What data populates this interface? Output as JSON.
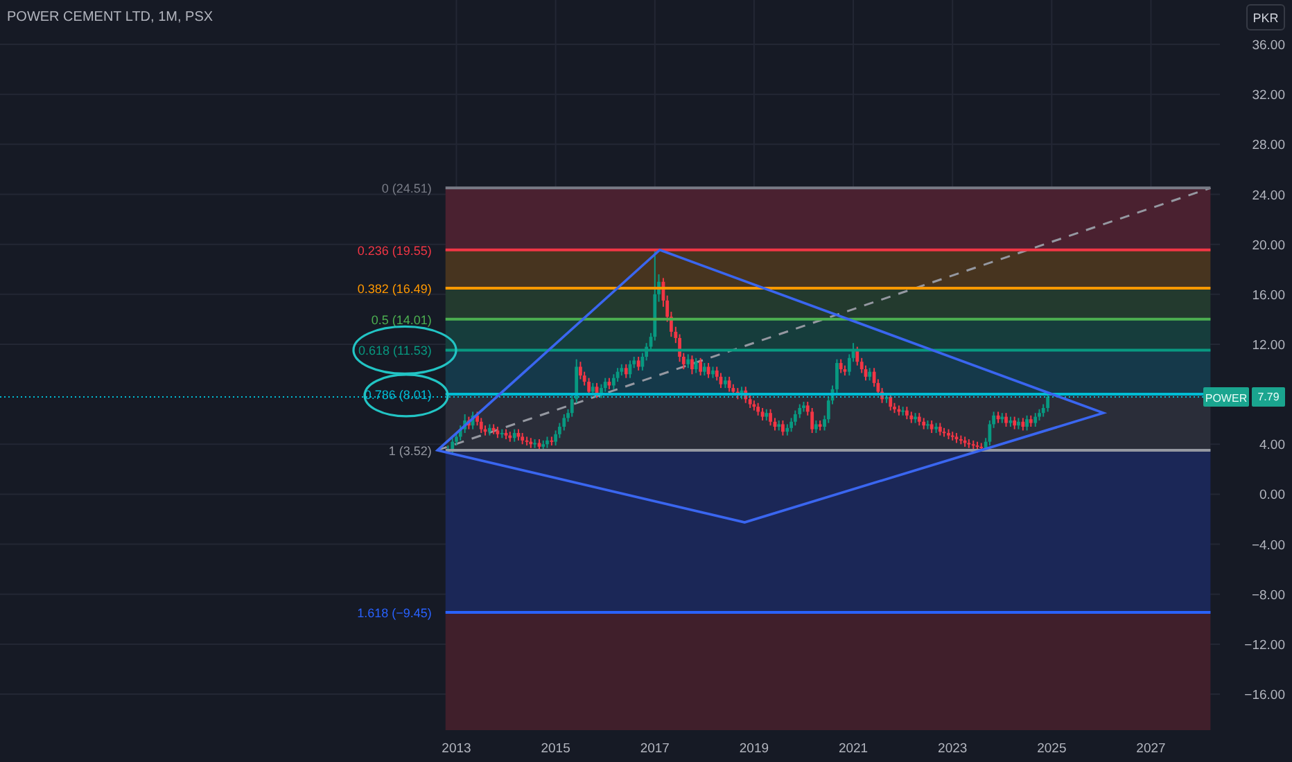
{
  "title": "POWER CEMENT LTD, 1M, PSX",
  "currency_button": "PKR",
  "chart": {
    "chart_data": {
      "type": "candlestick",
      "grid": true,
      "xlim": [
        2003.8,
        2028.39
      ],
      "ylim": [
        -18.88,
        39.55
      ],
      "xticks": [
        2013,
        2015,
        2017,
        2019,
        2021,
        2023,
        2025,
        2027
      ],
      "yticks": [
        {
          "value": 36,
          "label": "36.00"
        },
        {
          "value": 32,
          "label": "32.00"
        },
        {
          "value": 28,
          "label": "28.00"
        },
        {
          "value": 24,
          "label": "24.00"
        },
        {
          "value": 20,
          "label": "20.00"
        },
        {
          "value": 16,
          "label": "16.00"
        },
        {
          "value": 12,
          "label": "12.00"
        },
        {
          "value": 4,
          "label": "4.00"
        },
        {
          "value": 0,
          "label": "0.00"
        },
        {
          "value": -4,
          "label": "−4.00"
        },
        {
          "value": -8,
          "label": "−8.00"
        },
        {
          "value": -12,
          "label": "−12.00"
        },
        {
          "value": -16,
          "label": "−16.00"
        }
      ],
      "x": [
        2012.83,
        2012.92,
        2013.0,
        2013.08,
        2013.17,
        2013.25,
        2013.33,
        2013.42,
        2013.5,
        2013.58,
        2013.67,
        2013.75,
        2013.83,
        2013.92,
        2014.0,
        2014.08,
        2014.17,
        2014.25,
        2014.33,
        2014.42,
        2014.5,
        2014.58,
        2014.67,
        2014.75,
        2014.83,
        2014.92,
        2015.0,
        2015.08,
        2015.17,
        2015.25,
        2015.33,
        2015.42,
        2015.5,
        2015.58,
        2015.67,
        2015.75,
        2015.83,
        2015.92,
        2016.0,
        2016.08,
        2016.17,
        2016.25,
        2016.33,
        2016.42,
        2016.5,
        2016.58,
        2016.67,
        2016.75,
        2016.83,
        2016.92,
        2017.0,
        2017.08,
        2017.17,
        2017.25,
        2017.33,
        2017.42,
        2017.5,
        2017.58,
        2017.67,
        2017.75,
        2017.83,
        2017.92,
        2018.0,
        2018.08,
        2018.17,
        2018.25,
        2018.33,
        2018.42,
        2018.5,
        2018.58,
        2018.67,
        2018.75,
        2018.83,
        2018.92,
        2019.0,
        2019.08,
        2019.17,
        2019.25,
        2019.33,
        2019.42,
        2019.5,
        2019.58,
        2019.67,
        2019.75,
        2019.83,
        2019.92,
        2020.0,
        2020.08,
        2020.17,
        2020.25,
        2020.33,
        2020.42,
        2020.5,
        2020.58,
        2020.67,
        2020.75,
        2020.83,
        2020.92,
        2021.0,
        2021.08,
        2021.17,
        2021.25,
        2021.33,
        2021.42,
        2021.5,
        2021.58,
        2021.67,
        2021.75,
        2021.83,
        2021.92,
        2022.0,
        2022.08,
        2022.17,
        2022.25,
        2022.33,
        2022.42,
        2022.5,
        2022.58,
        2022.67,
        2022.75,
        2022.83,
        2022.92,
        2023.0,
        2023.08,
        2023.17,
        2023.25,
        2023.33,
        2023.42,
        2023.5,
        2023.58,
        2023.67,
        2023.75,
        2023.83,
        2023.92,
        2024.0,
        2024.08,
        2024.17,
        2024.25,
        2024.33,
        2024.42,
        2024.5,
        2024.58,
        2024.67,
        2024.75,
        2024.83,
        2024.92
      ],
      "ohlc": [
        [
          3.5,
          3.9,
          3.3,
          3.6
        ],
        [
          3.6,
          4.5,
          3.3,
          4.2
        ],
        [
          4.2,
          4.9,
          3.9,
          4.6
        ],
        [
          4.6,
          5.5,
          4.3,
          5.2
        ],
        [
          5.2,
          6.4,
          4.9,
          5.9
        ],
        [
          5.9,
          6.2,
          5.2,
          5.5
        ],
        [
          5.5,
          6.6,
          5.2,
          6.3
        ],
        [
          6.3,
          6.6,
          5.5,
          5.8
        ],
        [
          5.8,
          6.1,
          4.9,
          5.2
        ],
        [
          5.2,
          5.5,
          4.7,
          5.0
        ],
        [
          5.0,
          5.6,
          4.7,
          5.3
        ],
        [
          5.3,
          5.6,
          4.8,
          5.1
        ],
        [
          5.1,
          5.4,
          4.5,
          4.8
        ],
        [
          4.8,
          5.2,
          4.5,
          4.9
        ],
        [
          4.9,
          5.2,
          4.4,
          4.7
        ],
        [
          4.7,
          5.0,
          4.2,
          4.5
        ],
        [
          4.5,
          5.2,
          4.2,
          4.9
        ],
        [
          4.9,
          5.2,
          4.3,
          4.6
        ],
        [
          4.6,
          4.9,
          4.0,
          4.3
        ],
        [
          4.3,
          4.6,
          3.9,
          4.2
        ],
        [
          4.2,
          4.5,
          3.7,
          4.0
        ],
        [
          4.0,
          4.4,
          3.7,
          4.1
        ],
        [
          4.1,
          4.4,
          3.5,
          3.8
        ],
        [
          3.8,
          4.3,
          3.5,
          4.0
        ],
        [
          4.0,
          4.6,
          3.7,
          4.3
        ],
        [
          4.3,
          4.6,
          3.9,
          4.2
        ],
        [
          4.2,
          5.1,
          3.9,
          4.8
        ],
        [
          4.8,
          5.7,
          4.5,
          5.4
        ],
        [
          5.4,
          6.4,
          5.1,
          6.1
        ],
        [
          6.1,
          6.8,
          5.8,
          6.5
        ],
        [
          6.5,
          7.9,
          6.2,
          7.6
        ],
        [
          7.6,
          10.8,
          7.3,
          10.2
        ],
        [
          10.2,
          10.6,
          9.2,
          9.5
        ],
        [
          9.5,
          9.8,
          8.7,
          9.0
        ],
        [
          9.0,
          9.3,
          7.9,
          8.2
        ],
        [
          8.2,
          8.9,
          7.9,
          8.6
        ],
        [
          8.6,
          8.9,
          7.7,
          8.0
        ],
        [
          8.0,
          8.8,
          7.7,
          8.5
        ],
        [
          8.5,
          9.3,
          8.2,
          9.0
        ],
        [
          9.0,
          9.3,
          8.4,
          8.7
        ],
        [
          8.7,
          9.6,
          8.4,
          9.3
        ],
        [
          9.3,
          10.1,
          9.0,
          9.8
        ],
        [
          9.8,
          10.4,
          9.5,
          10.1
        ],
        [
          10.1,
          10.4,
          9.3,
          9.6
        ],
        [
          9.6,
          10.7,
          9.3,
          10.4
        ],
        [
          10.4,
          11.0,
          10.1,
          10.7
        ],
        [
          10.7,
          11.0,
          9.9,
          10.2
        ],
        [
          10.2,
          11.3,
          9.9,
          11.0
        ],
        [
          11.0,
          12.1,
          10.7,
          11.8
        ],
        [
          11.8,
          12.9,
          11.5,
          12.6
        ],
        [
          12.6,
          19.55,
          12.3,
          16.0
        ],
        [
          16.0,
          17.6,
          15.4,
          17.0
        ],
        [
          17.0,
          17.3,
          15.0,
          15.5
        ],
        [
          15.5,
          15.9,
          13.8,
          14.2
        ],
        [
          14.2,
          14.6,
          12.6,
          13.0
        ],
        [
          13.0,
          13.4,
          12.1,
          12.5
        ],
        [
          12.5,
          12.8,
          10.6,
          11.0
        ],
        [
          11.0,
          11.3,
          10.0,
          10.4
        ],
        [
          10.4,
          11.2,
          10.1,
          10.8
        ],
        [
          10.8,
          11.1,
          9.6,
          10.0
        ],
        [
          10.0,
          10.9,
          9.7,
          10.6
        ],
        [
          10.6,
          10.9,
          9.5,
          9.8
        ],
        [
          9.8,
          10.5,
          9.5,
          10.2
        ],
        [
          10.2,
          10.5,
          9.3,
          9.6
        ],
        [
          9.6,
          10.2,
          9.3,
          9.9
        ],
        [
          9.9,
          10.2,
          9.1,
          9.4
        ],
        [
          9.4,
          9.7,
          8.5,
          8.8
        ],
        [
          8.8,
          9.4,
          8.5,
          9.1
        ],
        [
          9.1,
          9.4,
          8.2,
          8.5
        ],
        [
          8.5,
          8.8,
          7.9,
          8.2
        ],
        [
          8.2,
          8.5,
          7.6,
          7.9
        ],
        [
          7.9,
          8.6,
          7.6,
          8.3
        ],
        [
          8.3,
          8.6,
          7.3,
          7.6
        ],
        [
          7.6,
          7.9,
          6.9,
          7.2
        ],
        [
          7.2,
          7.5,
          6.7,
          7.0
        ],
        [
          7.0,
          7.3,
          6.3,
          6.6
        ],
        [
          6.6,
          6.9,
          5.9,
          6.2
        ],
        [
          6.2,
          6.8,
          5.9,
          6.5
        ],
        [
          6.5,
          6.8,
          5.5,
          5.8
        ],
        [
          5.8,
          6.1,
          5.1,
          5.4
        ],
        [
          5.4,
          5.9,
          5.1,
          5.6
        ],
        [
          5.6,
          5.9,
          4.7,
          5.0
        ],
        [
          5.0,
          5.6,
          4.7,
          5.3
        ],
        [
          5.3,
          6.1,
          5.0,
          5.8
        ],
        [
          5.8,
          6.7,
          5.5,
          6.4
        ],
        [
          6.4,
          7.2,
          6.1,
          6.9
        ],
        [
          6.9,
          7.4,
          6.6,
          7.1
        ],
        [
          7.1,
          7.4,
          6.3,
          6.6
        ],
        [
          6.6,
          6.9,
          4.9,
          5.2
        ],
        [
          5.2,
          5.9,
          4.9,
          5.6
        ],
        [
          5.6,
          5.9,
          5.1,
          5.4
        ],
        [
          5.4,
          6.3,
          5.1,
          6.0
        ],
        [
          6.0,
          7.8,
          5.7,
          7.5
        ],
        [
          7.5,
          8.7,
          7.2,
          8.4
        ],
        [
          8.4,
          10.8,
          8.1,
          10.5
        ],
        [
          10.5,
          10.8,
          9.7,
          10.0
        ],
        [
          10.0,
          10.3,
          9.5,
          9.8
        ],
        [
          9.8,
          11.2,
          9.5,
          10.9
        ],
        [
          10.9,
          12.1,
          10.6,
          11.5
        ],
        [
          11.5,
          11.8,
          10.3,
          10.6
        ],
        [
          10.6,
          10.9,
          9.7,
          10.0
        ],
        [
          10.0,
          10.3,
          9.1,
          9.4
        ],
        [
          9.4,
          10.1,
          9.1,
          9.8
        ],
        [
          9.8,
          10.1,
          8.6,
          8.9
        ],
        [
          8.9,
          9.2,
          7.9,
          8.2
        ],
        [
          8.2,
          8.5,
          7.3,
          7.6
        ],
        [
          7.6,
          8.1,
          7.3,
          7.8
        ],
        [
          7.8,
          8.1,
          6.7,
          7.0
        ],
        [
          7.0,
          7.3,
          6.5,
          6.8
        ],
        [
          6.8,
          7.1,
          6.3,
          6.6
        ],
        [
          6.6,
          7.0,
          6.3,
          6.7
        ],
        [
          6.7,
          7.0,
          6.0,
          6.3
        ],
        [
          6.3,
          6.6,
          5.7,
          6.0
        ],
        [
          6.0,
          6.5,
          5.7,
          6.2
        ],
        [
          6.2,
          6.5,
          5.5,
          5.8
        ],
        [
          5.8,
          6.1,
          5.2,
          5.5
        ],
        [
          5.5,
          5.9,
          5.2,
          5.6
        ],
        [
          5.6,
          5.9,
          4.9,
          5.2
        ],
        [
          5.2,
          5.7,
          4.9,
          5.4
        ],
        [
          5.4,
          5.7,
          4.7,
          5.0
        ],
        [
          5.0,
          5.3,
          4.6,
          4.9
        ],
        [
          4.9,
          5.2,
          4.4,
          4.7
        ],
        [
          4.7,
          5.0,
          4.3,
          4.6
        ],
        [
          4.6,
          4.9,
          4.1,
          4.4
        ],
        [
          4.4,
          4.7,
          4.0,
          4.3
        ],
        [
          4.3,
          4.6,
          3.8,
          4.1
        ],
        [
          4.1,
          4.4,
          3.7,
          4.0
        ],
        [
          4.0,
          4.3,
          3.6,
          3.9
        ],
        [
          3.9,
          4.2,
          3.5,
          3.8
        ],
        [
          3.8,
          4.1,
          3.5,
          3.7
        ],
        [
          3.7,
          4.5,
          3.4,
          4.2
        ],
        [
          4.2,
          5.9,
          3.9,
          5.6
        ],
        [
          5.6,
          6.6,
          5.3,
          6.3
        ],
        [
          6.3,
          6.6,
          5.7,
          6.0
        ],
        [
          6.0,
          6.5,
          5.7,
          6.2
        ],
        [
          6.2,
          6.5,
          5.4,
          5.7
        ],
        [
          5.7,
          6.2,
          5.4,
          5.9
        ],
        [
          5.9,
          6.2,
          5.2,
          5.5
        ],
        [
          5.5,
          6.1,
          5.2,
          5.8
        ],
        [
          5.8,
          6.1,
          5.1,
          5.4
        ],
        [
          5.4,
          6.3,
          5.1,
          6.0
        ],
        [
          6.0,
          6.3,
          5.4,
          5.7
        ],
        [
          5.7,
          6.5,
          5.4,
          6.2
        ],
        [
          6.2,
          6.8,
          5.9,
          6.5
        ],
        [
          6.5,
          7.2,
          6.2,
          6.9
        ],
        [
          6.9,
          8.1,
          6.6,
          7.79
        ]
      ],
      "bands": [
        {
          "axis": "y",
          "from": 24.51,
          "to": 19.55,
          "color": "#4a2130"
        },
        {
          "axis": "y",
          "from": 19.55,
          "to": 16.49,
          "color": "#47341f"
        },
        {
          "axis": "y",
          "from": 16.49,
          "to": 14.01,
          "color": "#233a2e"
        },
        {
          "axis": "y",
          "from": 14.01,
          "to": 11.53,
          "color": "#163d3c"
        },
        {
          "axis": "y",
          "from": 11.53,
          "to": 8.01,
          "color": "#15394a"
        },
        {
          "axis": "y",
          "from": 8.01,
          "to": 3.52,
          "color": "#2a2d39"
        },
        {
          "axis": "y",
          "from": 3.52,
          "to": -9.45,
          "color": "#1b2757"
        },
        {
          "axis": "y",
          "from": -9.45,
          "to": -18.88,
          "color": "#401f2b"
        }
      ],
      "ref_lines": [
        {
          "axis": "y",
          "value": 24.51,
          "label": "0 (24.51)",
          "color": "#787b86"
        },
        {
          "axis": "y",
          "value": 19.55,
          "label": "0.236 (19.55)",
          "color": "#f23645"
        },
        {
          "axis": "y",
          "value": 16.49,
          "label": "0.382 (16.49)",
          "color": "#ff9800"
        },
        {
          "axis": "y",
          "value": 14.01,
          "label": "0.5 (14.01)",
          "color": "#4caf50"
        },
        {
          "axis": "y",
          "value": 11.53,
          "label": "0.618 (11.53)",
          "color": "#089981"
        },
        {
          "axis": "y",
          "value": 8.01,
          "label": "0.786 (8.01)",
          "color": "#00bcd4"
        },
        {
          "axis": "y",
          "value": 3.52,
          "label": "1 (3.52)",
          "color": "#9598a1"
        },
        {
          "axis": "y",
          "value": -9.45,
          "label": "1.618 (−9.45)",
          "color": "#2962ff"
        },
        {
          "axis": "y",
          "value": 7.79,
          "label": "7.79",
          "color": "#00bcd4"
        }
      ]
    },
    "last_price_tag": {
      "symbol": "POWER"
    }
  }
}
